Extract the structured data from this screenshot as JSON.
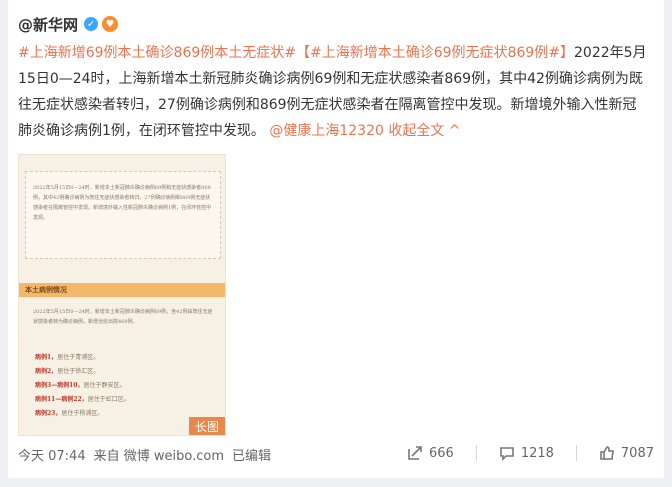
{
  "post": {
    "username": "@新华网",
    "tag1": "#上海新增69例本土确诊869例本土无症状#",
    "tag2": "【#上海新增本土确诊69例无症状869例#】",
    "body": "2022年5月15日0—24时，上海新增本土新冠肺炎确诊病例69例和无症状感染者869例，其中42例确诊病例为既往无症状感染者转归，27例确诊病例和869例无症状感染者在隔离管控中发现。新增境外输入性新冠肺炎确诊病例1例，在闭环管控中发现。",
    "mention": "@健康上海12320",
    "collapse": "收起全文 ^",
    "image": {
      "doc_para1": "2022年5月15日0—24时，新增本土新冠肺炎确诊病例69例和无症状感染者869例，其中42例确诊病例为既往无症状感染者转归，27例确诊病例和869例无症状感染者在隔离管控中发现。新增境外输入性新冠肺炎确诊病例1例，在闭环管控中发现。",
      "section_title": "本土病例情况",
      "doc_para2": "2022年5月15日0—24时，新增本土新冠肺炎确诊病例69例，含42例由既往无症状感染者转为确诊病例。新增治愈出院468例。",
      "cases": [
        {
          "label": "病例1，",
          "text": "居住于青浦区。"
        },
        {
          "label": "病例2，",
          "text": "居住于徐汇区。"
        },
        {
          "label": "病例3—病例10，",
          "text": "居住于静安区。"
        },
        {
          "label": "病例11—病例22，",
          "text": "居住于虹口区。"
        },
        {
          "label": "病例23，",
          "text": "居住于杨浦区。"
        }
      ],
      "long_badge": "长图"
    }
  },
  "footer": {
    "time": "今天 07:44",
    "source": "来自 微博 weibo.com",
    "edited": "已编辑",
    "share_count": "666",
    "comment_count": "1218",
    "like_count": "7087"
  },
  "colors": {
    "accent": "#eb7350",
    "verified": "#3ea6ff"
  }
}
